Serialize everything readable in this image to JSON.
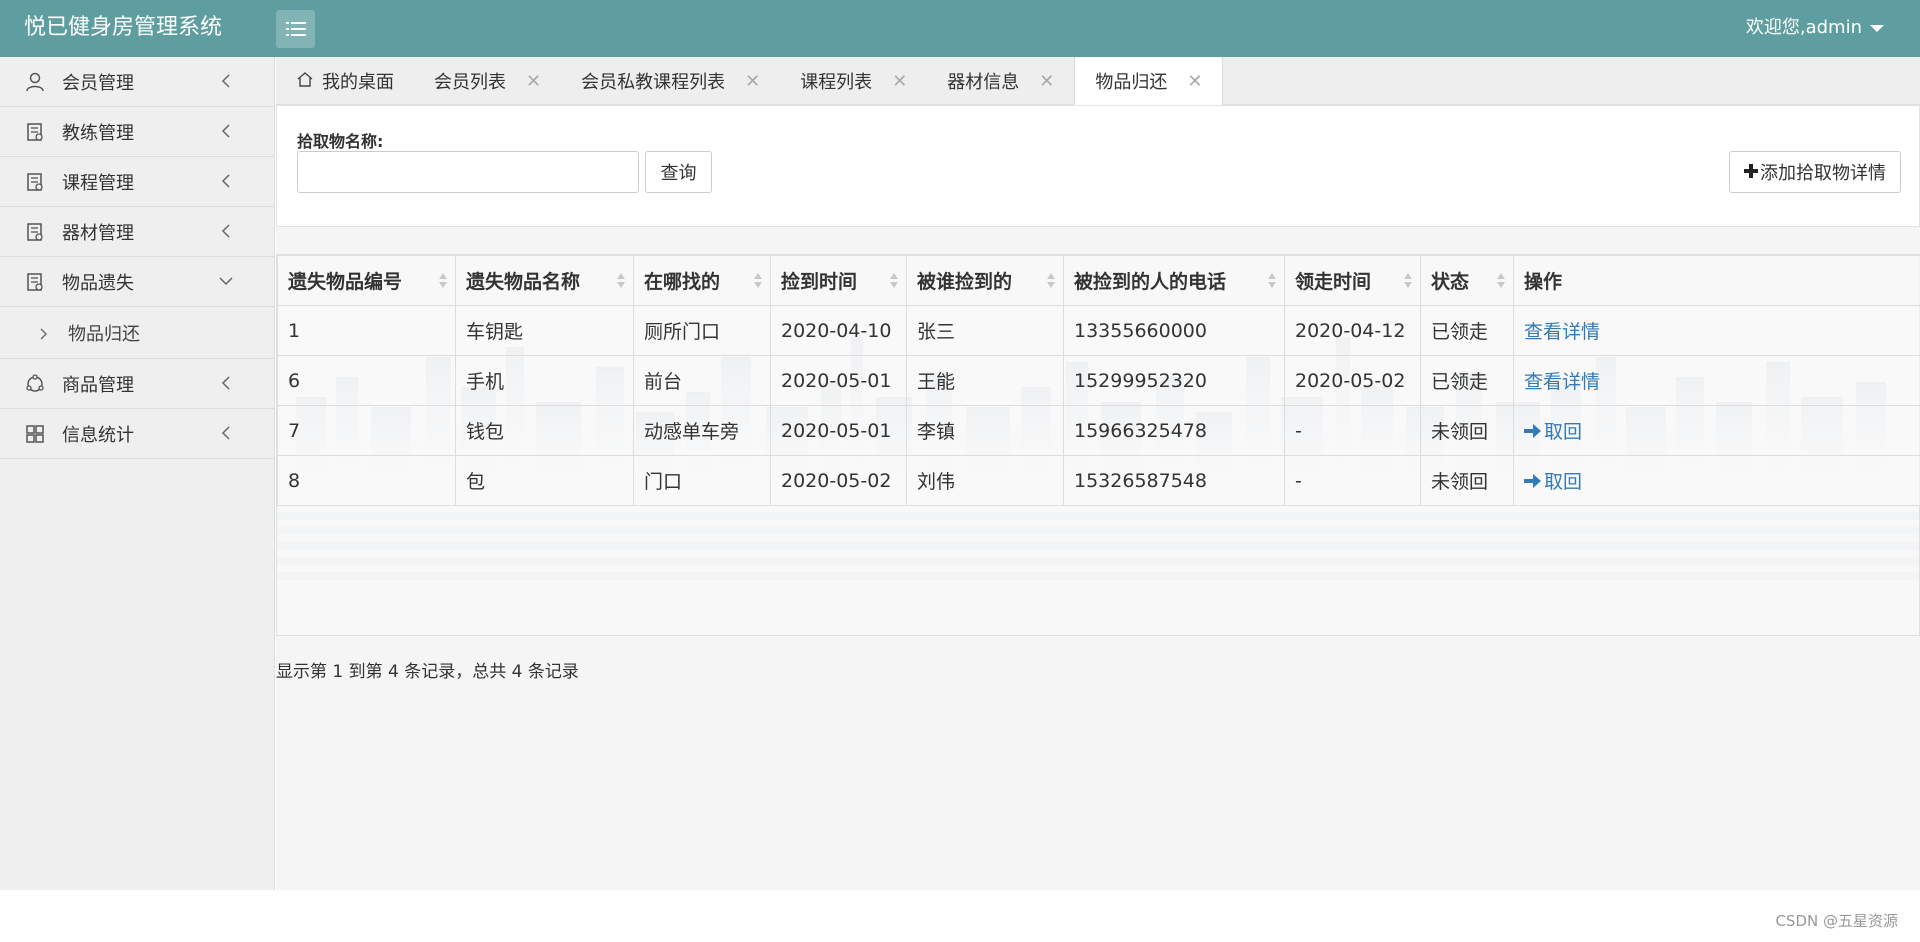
{
  "header": {
    "brand": "悦已健身房管理系统",
    "welcome": "欢迎您,admin"
  },
  "sidebar": {
    "items": [
      {
        "label": "会员管理",
        "icon": "user-icon"
      },
      {
        "label": "教练管理",
        "icon": "document-icon"
      },
      {
        "label": "课程管理",
        "icon": "document-icon"
      },
      {
        "label": "器材管理",
        "icon": "document-icon"
      },
      {
        "label": "物品遗失",
        "icon": "document-icon",
        "expanded": true
      },
      {
        "label": "商品管理",
        "icon": "cycle-icon"
      },
      {
        "label": "信息统计",
        "icon": "grid-icon"
      }
    ],
    "sub_items": [
      {
        "label": "物品归还"
      }
    ]
  },
  "tabs": [
    {
      "label": "我的桌面",
      "icon": "home-icon"
    },
    {
      "label": "会员列表"
    },
    {
      "label": "会员私教课程列表"
    },
    {
      "label": "课程列表"
    },
    {
      "label": "器材信息"
    },
    {
      "label": "物品归还",
      "active": true
    }
  ],
  "search": {
    "label": "拾取物名称:",
    "value": "",
    "query_button": "查询",
    "add_button": "添加拾取物详情"
  },
  "table": {
    "columns": [
      "遗失物品编号",
      "遗失物品名称",
      "在哪找的",
      "捡到时间",
      "被谁捡到的",
      "被捡到的人的电话",
      "领走时间",
      "状态",
      "操作"
    ],
    "rows": [
      {
        "id": "1",
        "name": "车钥匙",
        "where": "厕所门口",
        "found_time": "2020-04-10",
        "finder": "张三",
        "phone": "13355660000",
        "taken_time": "2020-04-12",
        "status": "已领走",
        "action": "查看详情",
        "action_type": "detail"
      },
      {
        "id": "6",
        "name": "手机",
        "where": "前台",
        "found_time": "2020-05-01",
        "finder": "王能",
        "phone": "15299952320",
        "taken_time": "2020-05-02",
        "status": "已领走",
        "action": "查看详情",
        "action_type": "detail"
      },
      {
        "id": "7",
        "name": "钱包",
        "where": "动感单车旁",
        "found_time": "2020-05-01",
        "finder": "李镇",
        "phone": "15966325478",
        "taken_time": "-",
        "status": "未领回",
        "action": "取回",
        "action_type": "retrieve"
      },
      {
        "id": "8",
        "name": "包",
        "where": "门口",
        "found_time": "2020-05-02",
        "finder": "刘伟",
        "phone": "15326587548",
        "taken_time": "-",
        "status": "未领回",
        "action": "取回",
        "action_type": "retrieve"
      }
    ]
  },
  "pagination": {
    "info": "显示第 1 到第 4 条记录，总共 4 条记录"
  },
  "footer": {
    "watermark": "CSDN @五星资源"
  },
  "colors": {
    "header": "#5f9ea0",
    "link": "#337ab7",
    "sidebar": "#efefef"
  }
}
